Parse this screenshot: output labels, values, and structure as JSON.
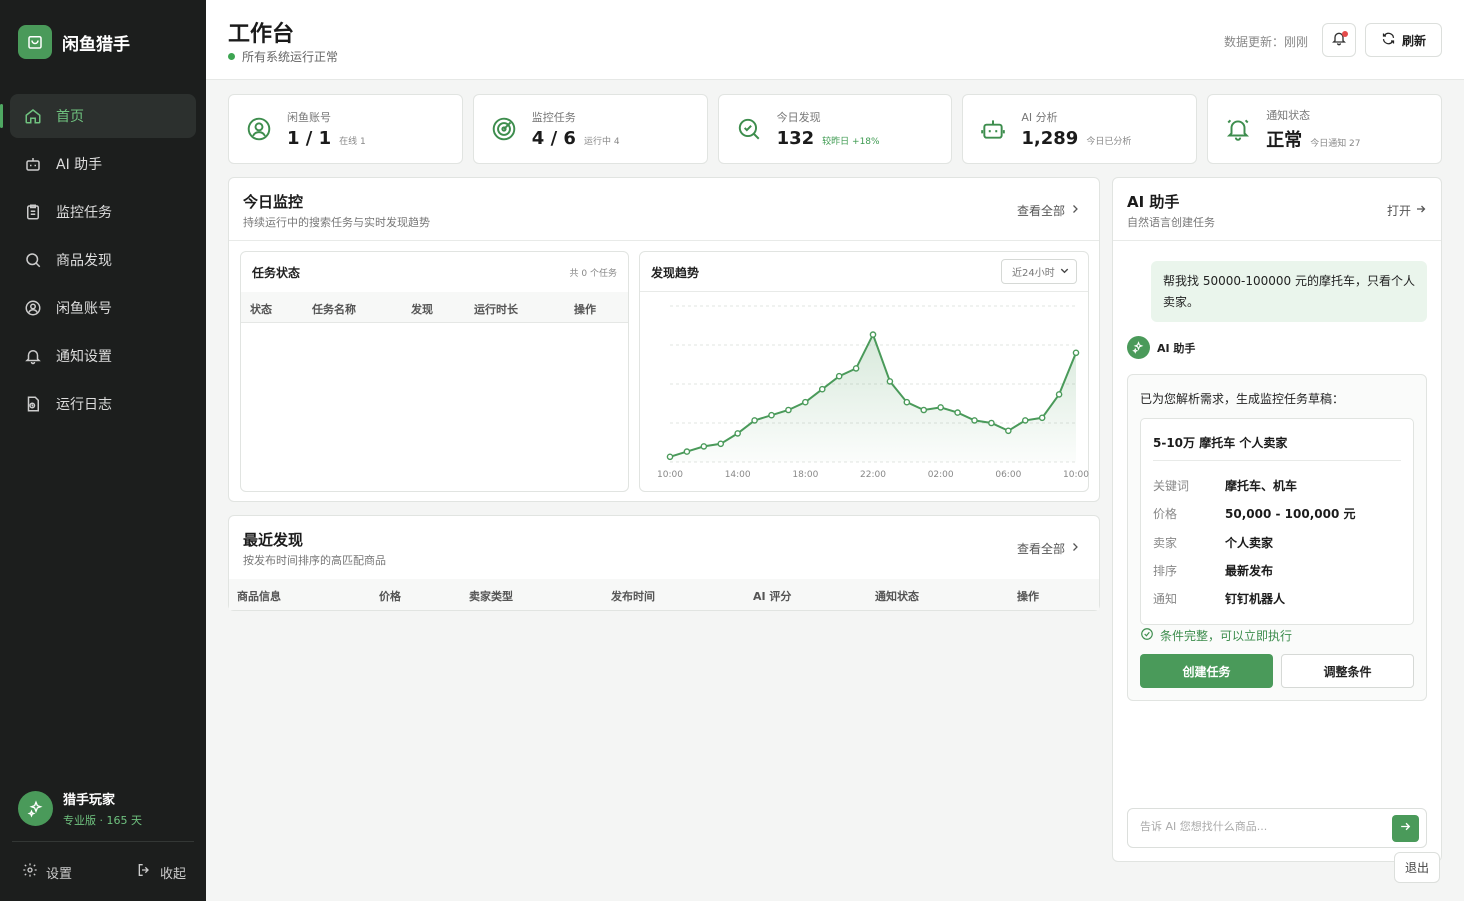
{
  "brand": {
    "name": "闲鱼猎手"
  },
  "sidebar": {
    "items": [
      {
        "label": "首页",
        "icon": "home-icon",
        "active": true
      },
      {
        "label": "AI 助手",
        "icon": "robot-icon"
      },
      {
        "label": "监控任务",
        "icon": "clipboard-icon"
      },
      {
        "label": "商品发现",
        "icon": "search-icon"
      },
      {
        "label": "闲鱼账号",
        "icon": "user-circle-icon"
      },
      {
        "label": "通知设置",
        "icon": "bell-icon"
      },
      {
        "label": "运行日志",
        "icon": "log-icon"
      }
    ],
    "user": {
      "name": "猎手玩家",
      "plan": "专业版 · 165 天"
    },
    "settings_label": "设置",
    "collapse_label": "收起"
  },
  "header": {
    "title": "工作台",
    "status": "所有系统运行正常",
    "update_text": "数据更新：刚刚",
    "refresh_label": "刷新"
  },
  "stats": [
    {
      "label": "闲鱼账号",
      "value": "1 / 1",
      "sub": "在线 1",
      "icon": "user-circle-icon"
    },
    {
      "label": "监控任务",
      "value": "4 / 6",
      "sub": "运行中 4",
      "icon": "radar-icon"
    },
    {
      "label": "今日发现",
      "value": "132",
      "sub": "较昨日 +18%",
      "icon": "search-check-icon"
    },
    {
      "label": "AI 分析",
      "value": "1,289",
      "sub": "今日已分析",
      "icon": "robot-icon"
    },
    {
      "label": "通知状态",
      "value": "正常",
      "sub": "今日通知 27",
      "icon": "bell-ring-icon"
    }
  ],
  "monitor": {
    "title": "今日监控",
    "subtitle": "持续运行中的搜索任务与实时发现趋势",
    "link": "查看全部",
    "task_status": {
      "title": "任务状态",
      "meta": "共 0 个任务",
      "columns": [
        "状态",
        "任务名称",
        "发现",
        "运行时长",
        "操作"
      ]
    },
    "trend": {
      "title": "发现趋势",
      "range": "近24小时"
    }
  },
  "recent": {
    "title": "最近发现",
    "subtitle": "按发布时间排序的高匹配商品",
    "link": "查看全部",
    "columns": [
      "商品信息",
      "价格",
      "卖家类型",
      "发布时间",
      "AI 评分",
      "通知状态",
      "操作"
    ]
  },
  "ai": {
    "title": "AI 助手",
    "subtitle": "自然语言创建任务",
    "open_label": "打开",
    "user_message": "帮我找 50000-100000 元的摩托车，只看个人卖家。",
    "bot_name": "AI 助手",
    "bot_intro": "已为您解析需求，生成监控任务草稿：",
    "draft": {
      "title": "5-10万 摩托车 个人卖家",
      "rows": [
        {
          "k": "关键词",
          "v": "摩托车、机车"
        },
        {
          "k": "价格",
          "v": "50,000 - 100,000 元"
        },
        {
          "k": "卖家",
          "v": "个人卖家"
        },
        {
          "k": "排序",
          "v": "最新发布"
        },
        {
          "k": "通知",
          "v": "钉钉机器人"
        }
      ]
    },
    "ready_text": "条件完整，可以立即执行",
    "create_label": "创建任务",
    "adjust_label": "调整条件",
    "input_placeholder": "告诉 AI 您想找什么商品...",
    "logout_label": "退出"
  },
  "colors": {
    "accent": "#4a9a5a",
    "sidebar_bg": "#1c1e1d",
    "alert": "#e34b4b"
  },
  "chart_data": {
    "type": "area",
    "x": [
      "10:00",
      "11:00",
      "12:00",
      "13:00",
      "14:00",
      "15:00",
      "16:00",
      "17:00",
      "18:00",
      "19:00",
      "20:00",
      "21:00",
      "22:00",
      "23:00",
      "00:00",
      "01:00",
      "02:00",
      "03:00",
      "04:00",
      "05:00",
      "06:00",
      "07:00",
      "08:00",
      "09:00",
      "10:00"
    ],
    "values": [
      2,
      4,
      6,
      7,
      11,
      16,
      18,
      20,
      23,
      28,
      33,
      36,
      49,
      31,
      23,
      20,
      21,
      19,
      16,
      15,
      12,
      16,
      17,
      26,
      42
    ],
    "x_tick_labels": [
      "10:00",
      "14:00",
      "18:00",
      "22:00",
      "02:00",
      "06:00",
      "10:00"
    ],
    "ylim": [
      0,
      60
    ],
    "grid": true,
    "color": "#4a9a5a"
  }
}
